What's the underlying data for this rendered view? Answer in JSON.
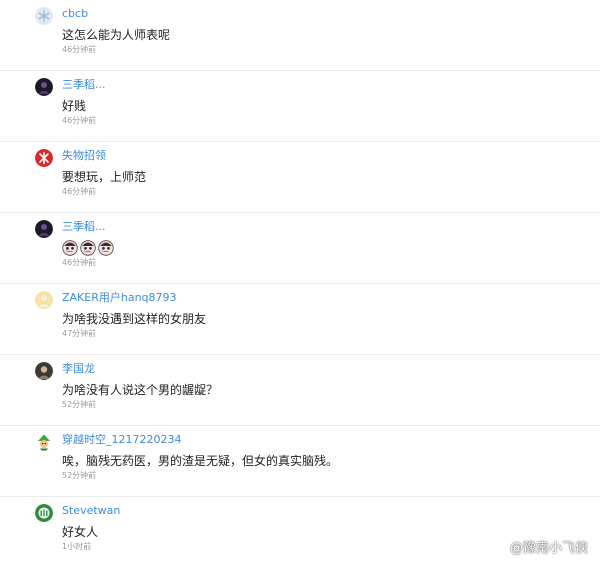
{
  "comments": [
    {
      "username": "cbcb",
      "text": "这怎么能为人师表呢",
      "time": "46分钟前",
      "avatar": "snowflake-avatar"
    },
    {
      "username": "三季稻...",
      "text": "好贱",
      "time": "46分钟前",
      "avatar": "dark-portrait-avatar"
    },
    {
      "username": "失物招领",
      "text": "要想玩，上师范",
      "time": "46分钟前",
      "avatar": "red-emblem-avatar"
    },
    {
      "username": "三季稻...",
      "text": "",
      "time": "46分钟前",
      "avatar": "dark-portrait-avatar",
      "emojis": [
        "crying-face-emoji",
        "crying-face-emoji",
        "crying-face-emoji"
      ]
    },
    {
      "username": "ZAKER用户hanq8793",
      "text": "为啥我没遇到这样的女朋友",
      "time": "47分钟前",
      "avatar": "default-user-avatar"
    },
    {
      "username": "李国龙",
      "text": "为啥没有人说这个男的龌龊？",
      "time": "52分钟前",
      "avatar": "photo-avatar"
    },
    {
      "username": "穿越时空_1217220234",
      "text": "唉，脑残无药医，男的渣是无疑，但女的真实脑残。",
      "time": "52分钟前",
      "avatar": "cartoon-avatar"
    },
    {
      "username": "Stevetwan",
      "text": "好女人",
      "time": "1小时前",
      "avatar": "green-avatar"
    }
  ],
  "watermark": {
    "text": "@豫南小飞侠",
    "icon": "camera-logo-icon"
  },
  "colors": {
    "username": "#3a8ddb",
    "text": "#222222",
    "time": "#9a9a9a",
    "divider": "#ececec"
  }
}
